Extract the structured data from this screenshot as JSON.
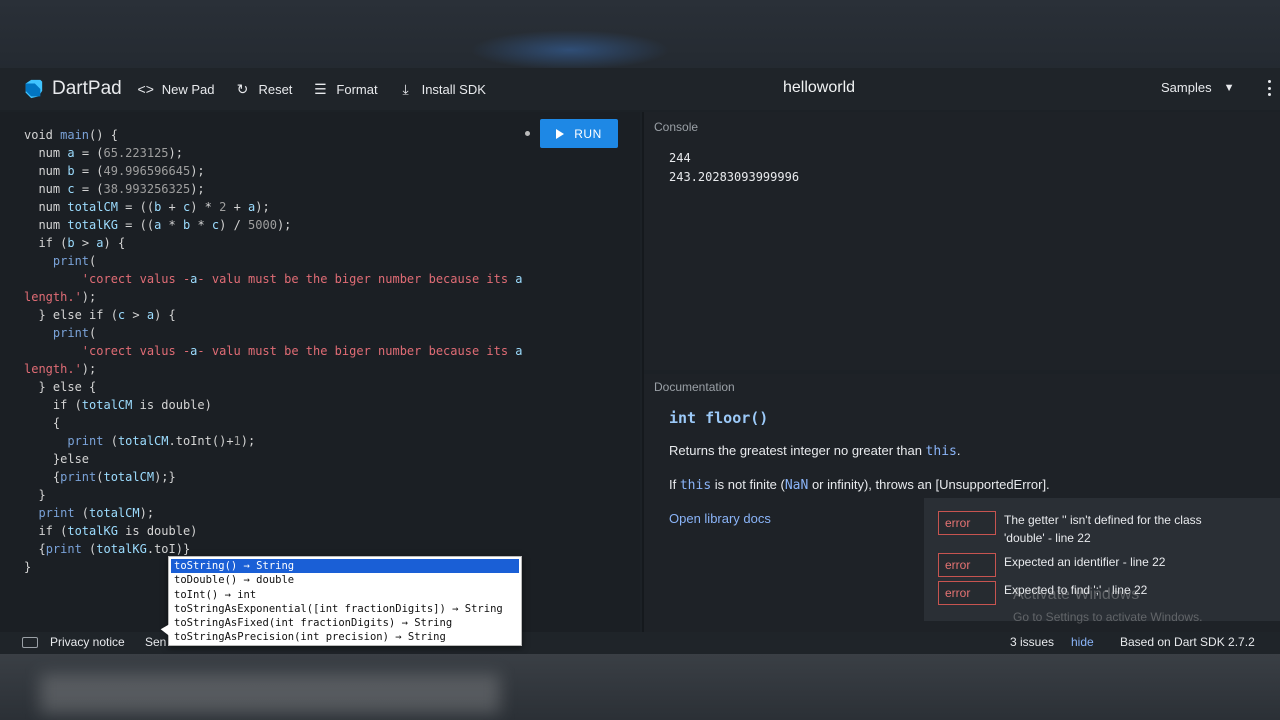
{
  "app": {
    "name": "DartPad",
    "pad_title": "helloworld"
  },
  "toolbar": {
    "new_pad": "New Pad",
    "reset": "Reset",
    "format": "Format",
    "install_sdk": "Install SDK",
    "samples": "Samples"
  },
  "editor": {
    "run_label": "RUN",
    "lines": [
      "void main() {",
      "  num a = (65.223125);",
      "  num b = (49.996596645);",
      "  num c = (38.993256325);",
      "  num totalCM = ((b + c) * 2 + a);",
      "  num totalKG = ((a * b * c) / 5000);",
      "  if (b > a) {",
      "    print(",
      "        'corect valus -a- valu must be the biger number because its a",
      "length.');",
      "  } else if (c > a) {",
      "    print(",
      "        'corect valus -a- valu must be the biger number because its a",
      "length.');",
      "  } else {",
      "    if (totalCM is double)",
      "    {",
      "      print (totalCM.toInt()+1);",
      "    }else",
      "    {print(totalCM);}",
      "  }",
      "  print (totalCM);",
      "  if (totalKG is double)",
      "  {print (totalKG.toI)}",
      "}"
    ]
  },
  "autocomplete": {
    "items": [
      "toString() → String",
      "toDouble() → double",
      "toInt() → int",
      "toStringAsExponential([int fractionDigits]) → String",
      "toStringAsFixed(int fractionDigits) → String",
      "toStringAsPrecision(int precision) → String"
    ]
  },
  "console": {
    "label": "Console",
    "output": "244\n243.20283093999996"
  },
  "documentation": {
    "label": "Documentation",
    "signature": "int floor()",
    "p1_prefix": "Returns the greatest integer no greater than ",
    "p1_code": "this",
    "p1_suffix": ".",
    "p2_prefix": "If ",
    "p2_code": "this",
    "p2_mid": " is not finite (",
    "p2_code2": "NaN",
    "p2_suffix": " or infinity), throws an [UnsupportedError].",
    "link": "Open library docs"
  },
  "issues": {
    "items": [
      {
        "badge": "error",
        "text": "The getter '' isn't defined for the class 'double' - line 22"
      },
      {
        "badge": "error",
        "text": "Expected an identifier - line 22"
      },
      {
        "badge": "error",
        "text": "Expected to find ';' - line 22"
      }
    ],
    "watermark_title": "Activate Windows",
    "watermark_sub": "Go to Settings to activate Windows."
  },
  "footer": {
    "privacy": "Privacy notice",
    "send": "Sen",
    "issues_count": "3 issues",
    "hide": "hide",
    "sdk": "Based on Dart SDK 2.7.2"
  },
  "colors": {
    "run_button": "#1e88e5",
    "string_literal": "#e06c75",
    "error_border": "#c75450",
    "link": "#8ab4f8"
  }
}
